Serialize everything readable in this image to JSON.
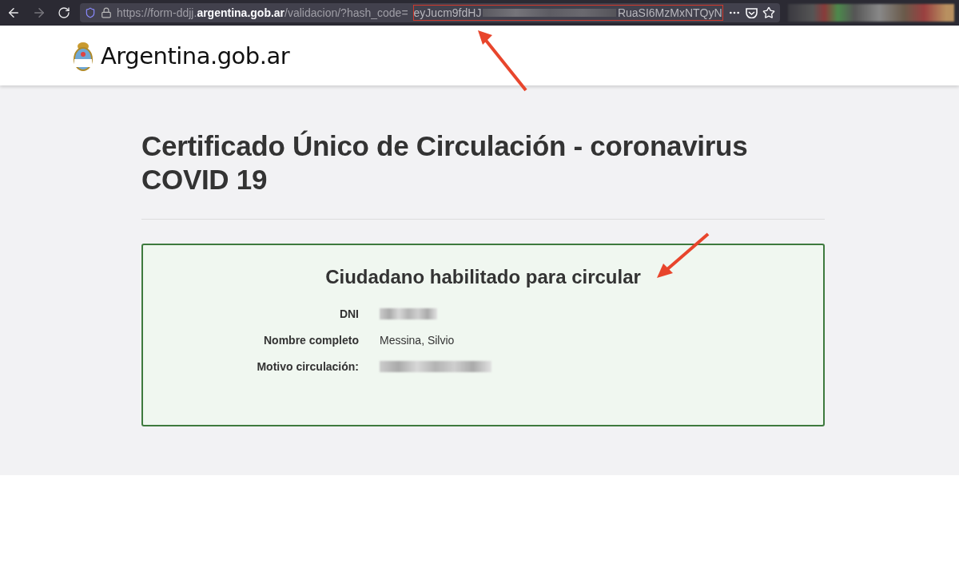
{
  "browser": {
    "back_enabled": true,
    "forward_enabled": false,
    "url": "https://form-ddjj.**argentina.gob.ar**/validacion/?hash_code=",
    "hash_start": "eyJucm9fdHJ",
    "hash_end": "RuaSI6MzMxNTQyN",
    "hash_highlighted": true
  },
  "header": {
    "brand": "Argentina.gob.ar"
  },
  "page": {
    "title": "Certificado Único de Circulación - coronavirus COVID 19"
  },
  "result": {
    "heading": "Ciudadano habilitado para circular",
    "valid": true,
    "fields": [
      {
        "label": "DNI",
        "redacted": true
      },
      {
        "label": "Nombre completo",
        "value": "Messina, Silvio",
        "redacted": false
      },
      {
        "label": "Motivo circulación:",
        "redacted": true
      }
    ]
  }
}
